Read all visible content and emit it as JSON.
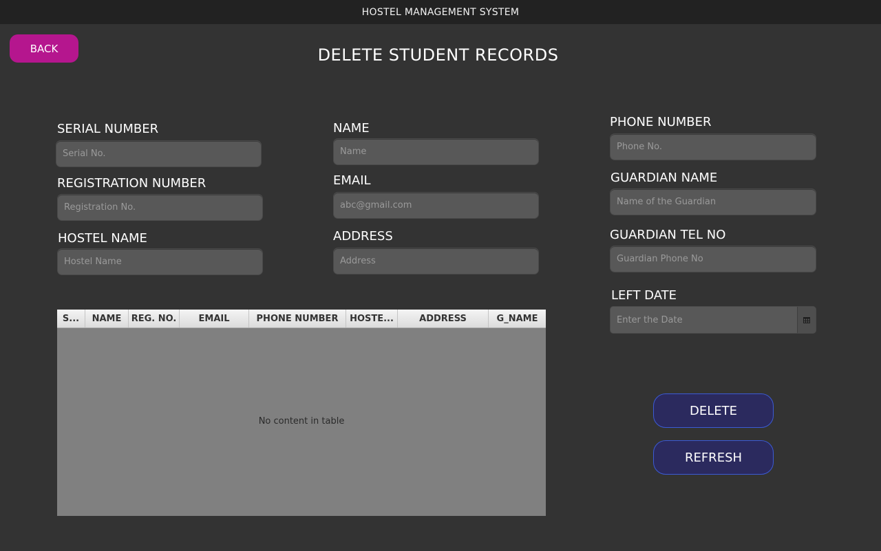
{
  "window": {
    "title": "HOSTEL MANAGEMENT SYSTEM"
  },
  "back_button": {
    "label": "BACK"
  },
  "page_title": "DELETE STUDENT RECORDS",
  "form": {
    "serial": {
      "label": "SERIAL NUMBER",
      "placeholder": "Serial No."
    },
    "registration": {
      "label": "REGISTRATION NUMBER",
      "placeholder": "Registration No."
    },
    "hostel": {
      "label": "HOSTEL NAME",
      "placeholder": "Hostel Name"
    },
    "name": {
      "label": "NAME",
      "placeholder": "Name"
    },
    "email": {
      "label": "EMAIL",
      "placeholder": "abc@gmail.com"
    },
    "address": {
      "label": "ADDRESS",
      "placeholder": "Address"
    },
    "phone": {
      "label": "PHONE NUMBER",
      "placeholder": "Phone No."
    },
    "guardian_name": {
      "label": "GUARDIAN NAME",
      "placeholder": "Name of the Guardian"
    },
    "guardian_tel": {
      "label": "GUARDIAN TEL NO",
      "placeholder": "Guardian Phone No"
    },
    "left_date": {
      "label": "LEFT DATE",
      "placeholder": "Enter the Date",
      "picker_icon": "calendar-icon"
    }
  },
  "table": {
    "columns": [
      "S...",
      "NAME",
      "REG. NO.",
      "EMAIL",
      "PHONE NUMBER",
      "HOSTE...",
      "ADDRESS",
      "G_NAME"
    ],
    "empty_message": "No content in table"
  },
  "actions": {
    "delete_label": "DELETE",
    "refresh_label": "REFRESH"
  },
  "colors": {
    "background": "#333333",
    "titlebar": "#222222",
    "back_button": "#b5168e",
    "action_button": "#2b2a5e",
    "action_border": "#3b5bd6",
    "field": "#585858",
    "table_body": "#808080"
  }
}
